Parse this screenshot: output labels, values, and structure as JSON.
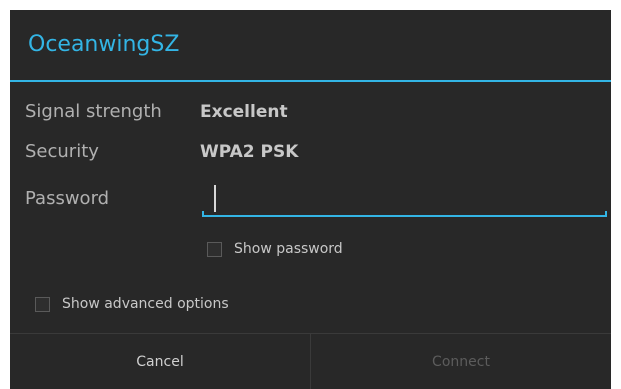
{
  "dialog": {
    "title": "OceanwingSZ"
  },
  "details": {
    "signal_label": "Signal strength",
    "signal_value": "Excellent",
    "security_label": "Security",
    "security_value": "WPA2 PSK"
  },
  "password": {
    "label": "Password",
    "value": "",
    "placeholder": ""
  },
  "options": {
    "show_password_label": "Show password",
    "show_password_checked": false,
    "show_advanced_label": "Show advanced options",
    "show_advanced_checked": false
  },
  "buttons": {
    "cancel_label": "Cancel",
    "connect_label": "Connect",
    "connect_enabled": false
  },
  "colors": {
    "accent": "#33b5e5",
    "dialog_background": "#282828",
    "page_background": "#ffffff",
    "disabled_text": "#5c5c5c"
  }
}
